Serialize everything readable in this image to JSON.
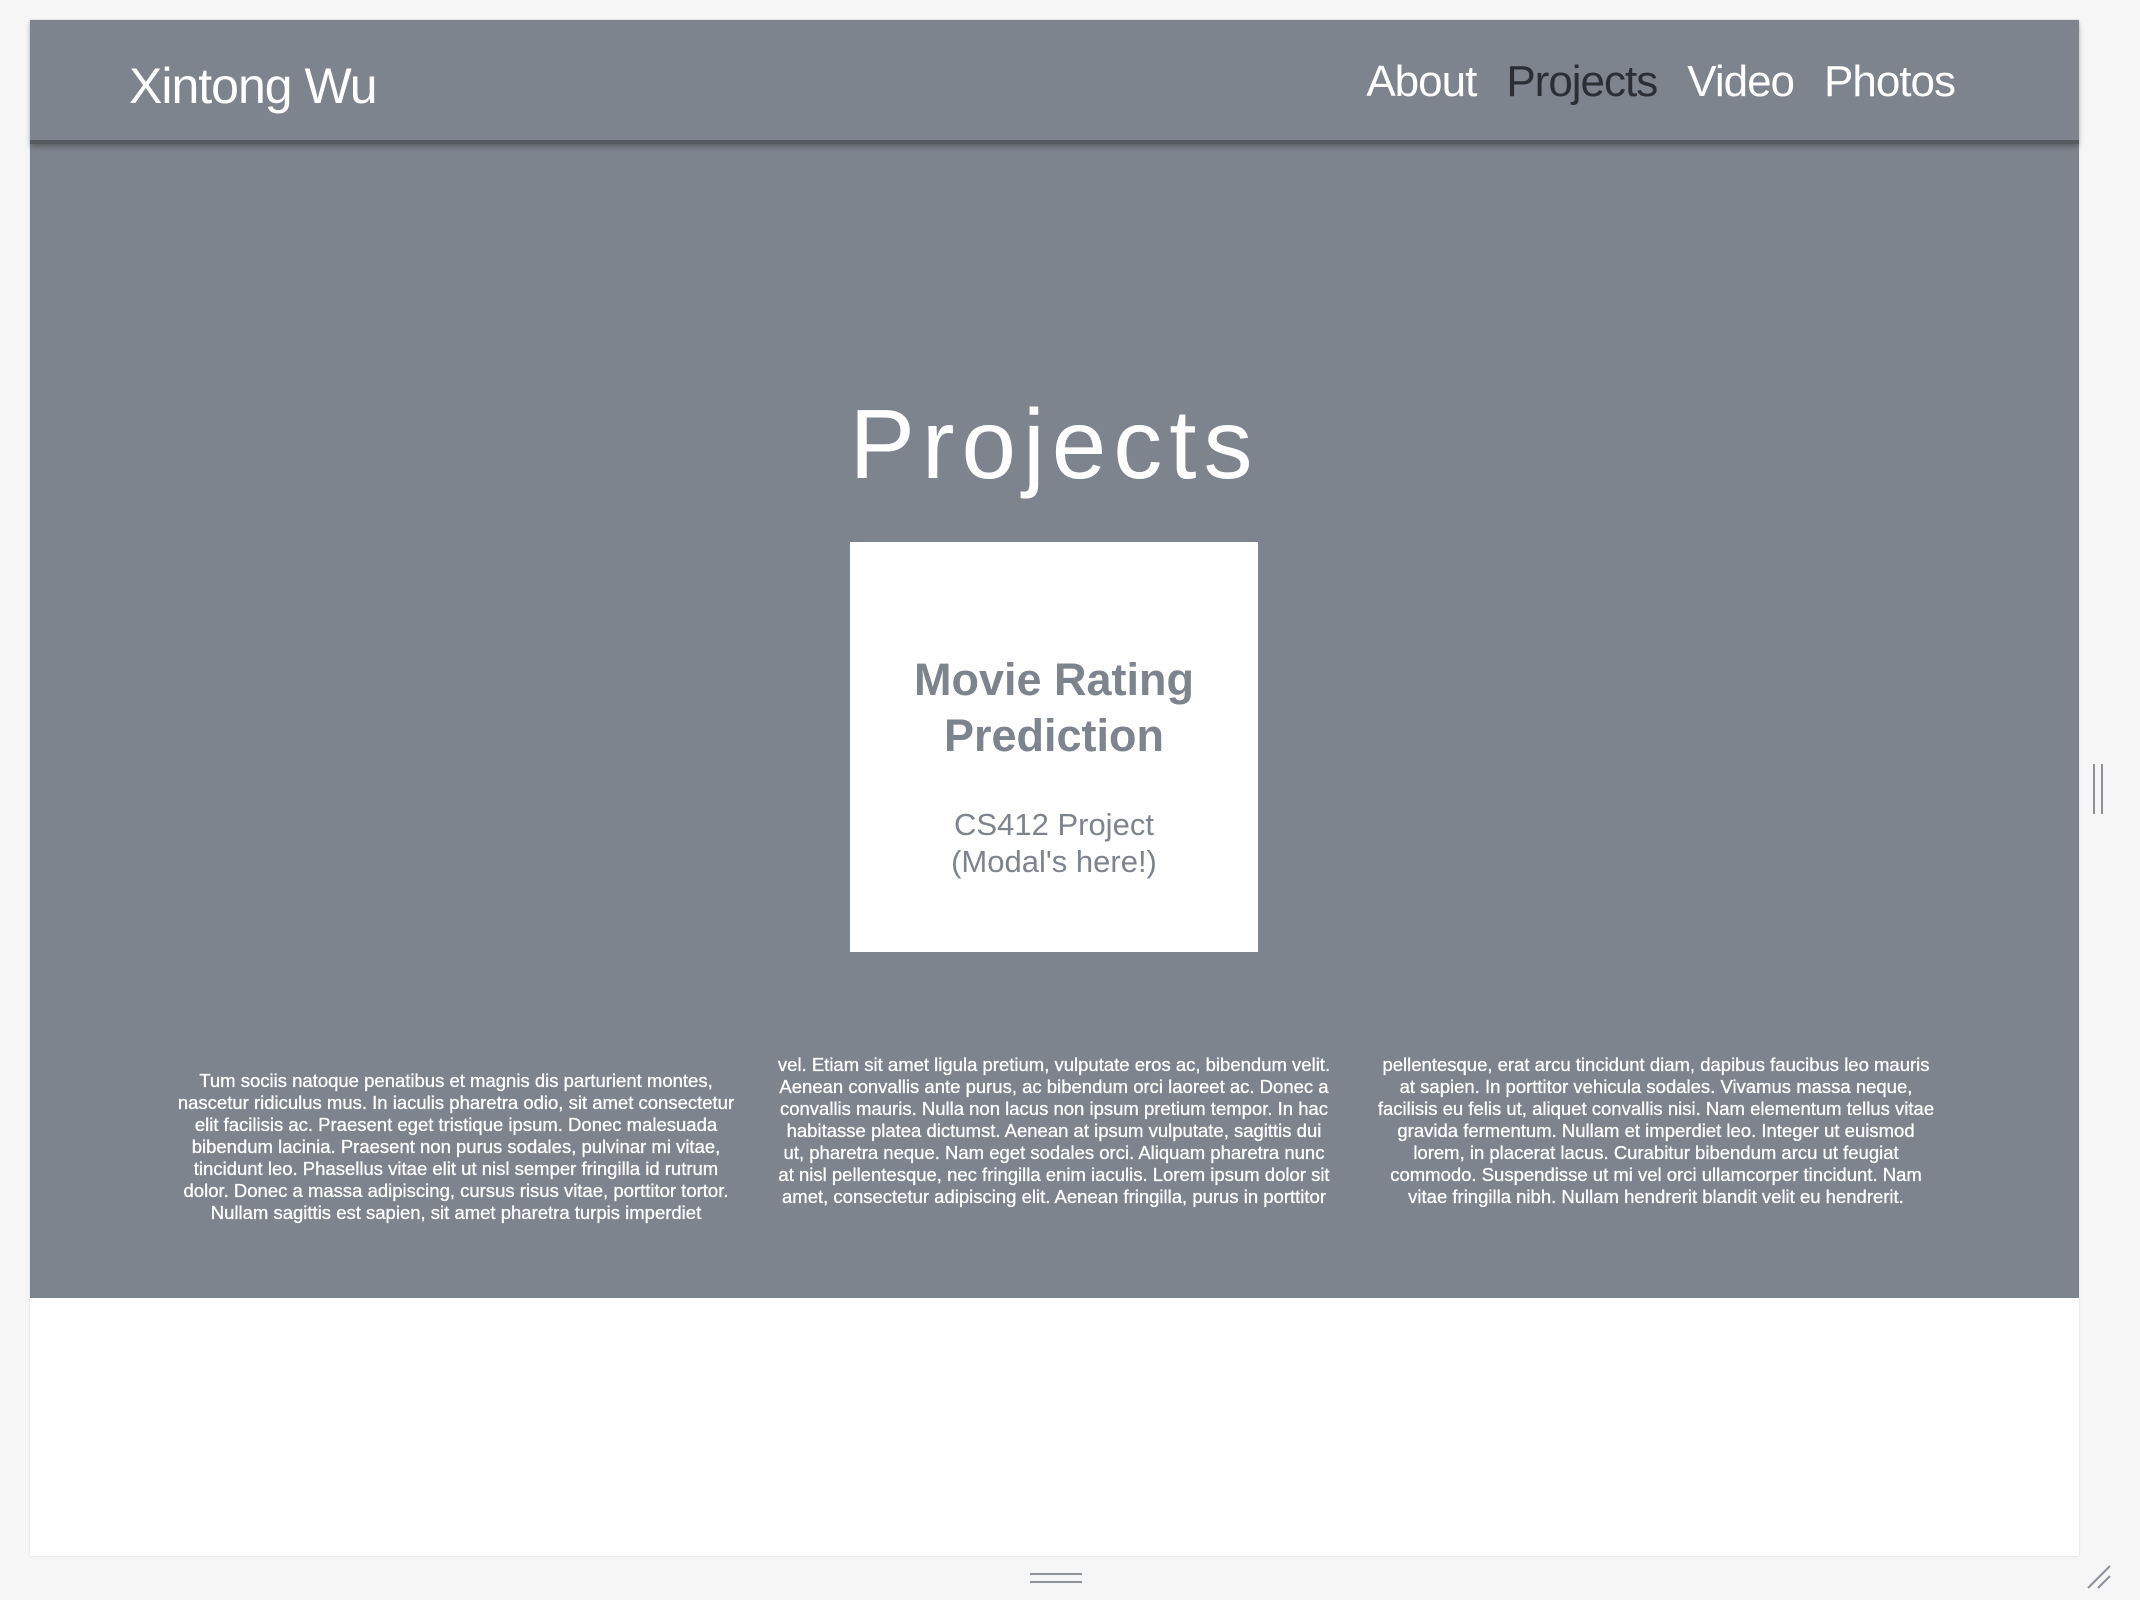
{
  "navbar": {
    "brand": "Xintong Wu",
    "links": [
      {
        "label": "About",
        "active": false
      },
      {
        "label": "Projects",
        "active": true
      },
      {
        "label": "Video",
        "active": false
      },
      {
        "label": "Photos",
        "active": false
      }
    ]
  },
  "main": {
    "title": "Projects",
    "card": {
      "title": "Movie Rating Prediction",
      "subtitle_line1": "CS412 Project",
      "subtitle_line2": "(Modal's here!)"
    },
    "columns": [
      "Tum sociis natoque penatibus et magnis dis parturient montes, nascetur ridiculus mus. In iaculis pharetra odio, sit amet consectetur elit facilisis ac. Praesent eget tristique ipsum. Donec malesuada bibendum lacinia. Praesent non purus sodales, pulvinar mi vitae, tincidunt leo. Phasellus vitae elit ut nisl semper fringilla id rutrum dolor. Donec a massa adipiscing, cursus risus vitae, porttitor tortor. Nullam sagittis est sapien, sit amet pharetra turpis imperdiet",
      "vel. Etiam sit amet ligula pretium, vulputate eros ac, bibendum velit. Aenean convallis ante purus, ac bibendum orci laoreet ac. Donec a convallis mauris. Nulla non lacus non ipsum pretium tempor. In hac habitasse platea dictumst. Aenean at ipsum vulputate, sagittis dui ut, pharetra neque. Nam eget sodales orci. Aliquam pharetra nunc at nisl pellentesque, nec fringilla enim iaculis. Lorem ipsum dolor sit amet, consectetur adipiscing elit. Aenean fringilla, purus in porttitor",
      "pellentesque, erat arcu tincidunt diam, dapibus faucibus leo mauris at sapien. In porttitor vehicula sodales. Vivamus massa neque, facilisis eu felis ut, aliquet convallis nisi. Nam elementum tellus vitae gravida fermentum. Nullam et imperdiet leo. Integer ut euismod lorem, in placerat lacus. Curabitur bibendum arcu ut feugiat commodo. Suspendisse ut mi vel orci ullamcorper tincidunt. Nam vitae fringilla nibh. Nullam hendrerit blandit velit eu hendrerit."
    ]
  },
  "colors": {
    "hero_background": "#7e848d",
    "active_link": "#2b2f35",
    "card_background": "#ffffff",
    "card_text": "#7e848d"
  },
  "icons": {
    "side_handle": "vertical-resize-handle-icon",
    "bottom_handle": "horizontal-resize-handle-icon",
    "corner": "corner-resize-icon"
  }
}
